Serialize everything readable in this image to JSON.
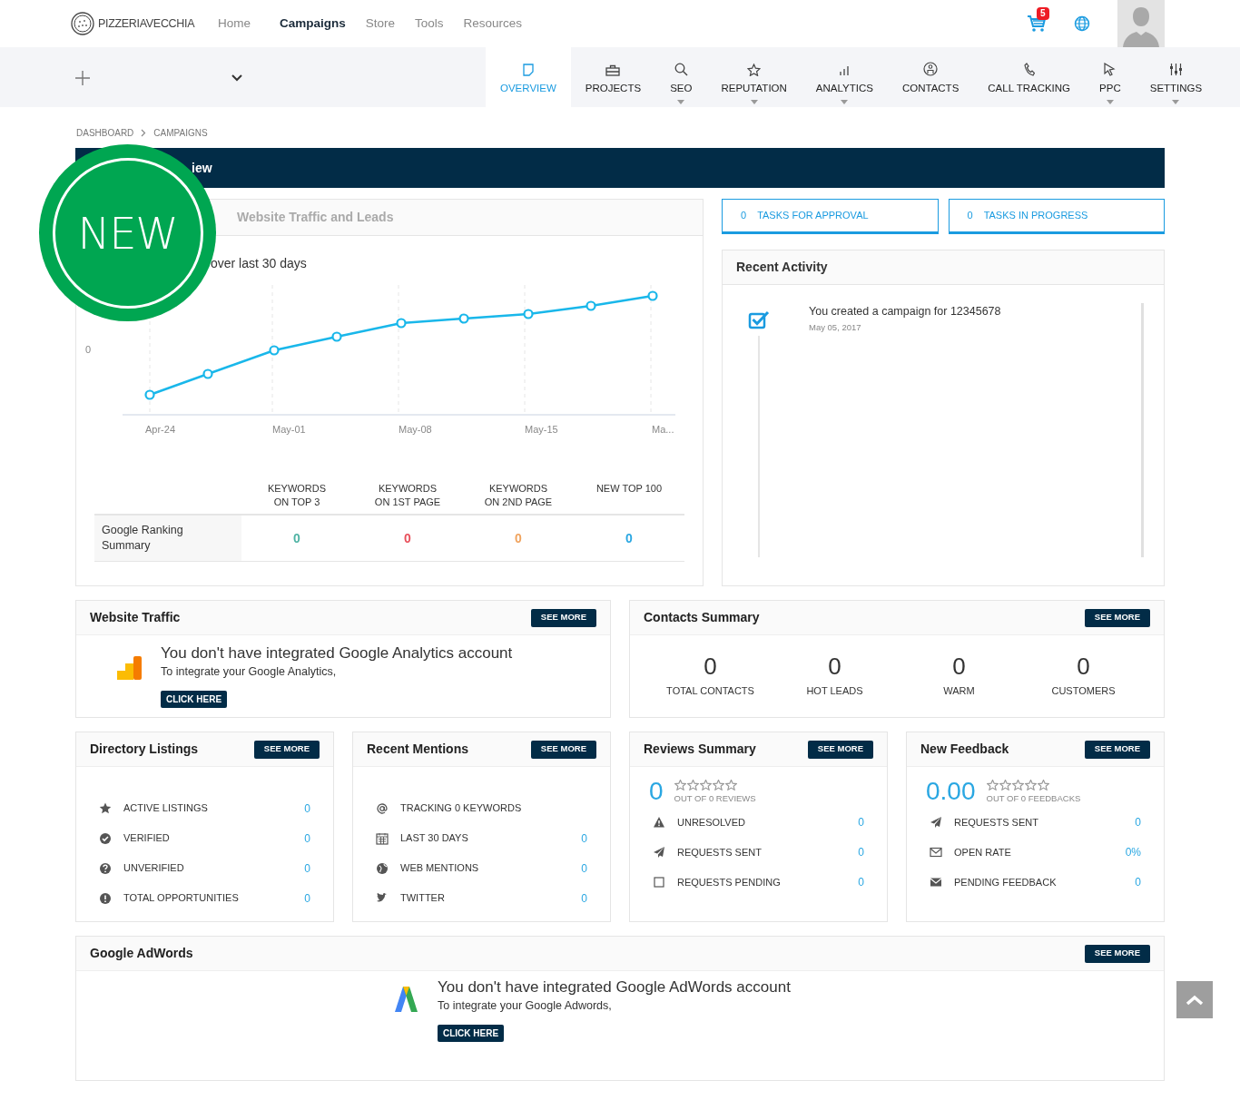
{
  "header": {
    "logo": "PIZZERIAVECCHIA",
    "nav": [
      {
        "label": "Home",
        "selected": false
      },
      {
        "label": "Campaigns",
        "selected": true
      },
      {
        "label": "Store",
        "selected": false
      },
      {
        "label": "Tools",
        "selected": false
      },
      {
        "label": "Resources",
        "selected": false
      }
    ],
    "cart_count": "5"
  },
  "toolbar": {
    "tabs": [
      {
        "label": "OVERVIEW",
        "selected": true,
        "dropdown": false
      },
      {
        "label": "PROJECTS",
        "selected": false,
        "dropdown": false
      },
      {
        "label": "SEO",
        "selected": false,
        "dropdown": true
      },
      {
        "label": "REPUTATION",
        "selected": false,
        "dropdown": true
      },
      {
        "label": "ANALYTICS",
        "selected": false,
        "dropdown": true
      },
      {
        "label": "CONTACTS",
        "selected": false,
        "dropdown": false
      },
      {
        "label": "CALL TRACKING",
        "selected": false,
        "dropdown": false
      },
      {
        "label": "PPC",
        "selected": false,
        "dropdown": true
      },
      {
        "label": "SETTINGS",
        "selected": false,
        "dropdown": true
      }
    ]
  },
  "breadcrumb": [
    "DASHBOARD",
    "CAMPAIGNS"
  ],
  "title_bar": "iew",
  "badge": "NEW",
  "traffic_panel": {
    "tab": "Website Traffic and Leads",
    "subtitle": "over last 30 days",
    "chart": {
      "y_tick": "0",
      "x_labels": [
        "Apr-24",
        "May-01",
        "May-08",
        "May-15",
        "Ma..."
      ]
    },
    "ranking": {
      "columns": [
        "KEYWORDS ON TOP 3",
        "KEYWORDS ON 1ST PAGE",
        "KEYWORDS ON 2ND PAGE",
        "NEW TOP 100"
      ],
      "row_label": "Google Ranking Summary",
      "values": [
        {
          "text": "0",
          "color": "#4fb3a4"
        },
        {
          "text": "0",
          "color": "#e8505b"
        },
        {
          "text": "0",
          "color": "#f0a35e"
        },
        {
          "text": "0",
          "color": "#2aa7e2"
        }
      ]
    }
  },
  "task_buttons": [
    {
      "count": "0",
      "label": "TASKS FOR APPROVAL"
    },
    {
      "count": "0",
      "label": "TASKS IN PROGRESS"
    }
  ],
  "recent_activity": {
    "title": "Recent Activity",
    "items": [
      {
        "text": "You created a campaign for 12345678",
        "date": "May 05, 2017"
      }
    ]
  },
  "website_traffic": {
    "title": "Website Traffic",
    "button": "SEE MORE",
    "message": "You don't have integrated Google Analytics account",
    "hint": "To integrate your Google Analytics,",
    "action": "CLICK HERE"
  },
  "contacts_summary": {
    "title": "Contacts Summary",
    "button": "SEE MORE",
    "stats": [
      {
        "value": "0",
        "label": "TOTAL CONTACTS"
      },
      {
        "value": "0",
        "label": "HOT LEADS"
      },
      {
        "value": "0",
        "label": "WARM"
      },
      {
        "value": "0",
        "label": "CUSTOMERS"
      }
    ]
  },
  "cards": [
    {
      "kind": "list",
      "title": "Directory Listings",
      "button": "SEE MORE",
      "rows": [
        {
          "label": "ACTIVE LISTINGS",
          "value": "0"
        },
        {
          "label": "VERIFIED",
          "value": "0"
        },
        {
          "label": "UNVERIFIED",
          "value": "0"
        },
        {
          "label": "TOTAL OPPORTUNITIES",
          "value": "0"
        }
      ]
    },
    {
      "kind": "list",
      "title": "Recent Mentions",
      "button": "SEE MORE",
      "rows": [
        {
          "label": "TRACKING 0 KEYWORDS"
        },
        {
          "label": "LAST 30 DAYS",
          "value": "0"
        },
        {
          "label": "WEB MENTIONS",
          "value": "0"
        },
        {
          "label": "TWITTER",
          "value": "0"
        }
      ]
    },
    {
      "kind": "rating",
      "title": "Reviews Summary",
      "button": "SEE MORE",
      "score": "0",
      "stars": 0,
      "caption": "OUT OF 0 REVIEWS",
      "rows": [
        {
          "label": "UNRESOLVED",
          "value": "0"
        },
        {
          "label": "REQUESTS SENT",
          "value": "0"
        },
        {
          "label": "REQUESTS PENDING",
          "value": "0"
        }
      ]
    },
    {
      "kind": "rating",
      "title": "New Feedback",
      "button": "SEE MORE",
      "score": "0.00",
      "stars": 0,
      "caption": "OUT OF 0 FEEDBACKS",
      "rows": [
        {
          "label": "REQUESTS SENT",
          "value": "0"
        },
        {
          "label": "OPEN RATE",
          "value": "0%"
        },
        {
          "label": "PENDING FEEDBACK",
          "value": "0"
        }
      ]
    }
  ],
  "adwords": {
    "title": "Google AdWords",
    "button": "SEE MORE",
    "message": "You don't have integrated Google AdWords account",
    "hint": "To integrate your Google Adwords,",
    "action": "CLICK HERE"
  }
}
